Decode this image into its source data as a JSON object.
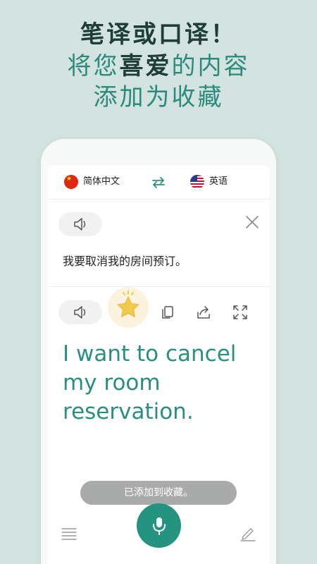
{
  "promo": {
    "line1": "笔译或口译！",
    "line2_pre": "将您",
    "line2_bold": "喜爱",
    "line2_post": "的内容",
    "line3": "添加为收藏"
  },
  "language_bar": {
    "source_language": "简体中文",
    "target_language": "英语",
    "source_flag": "china-flag-icon",
    "target_flag": "usa-flag-icon"
  },
  "source": {
    "text": "我要取消我的房间预订。"
  },
  "result": {
    "text": "I want to cancel my room reservation."
  },
  "toast": {
    "message": "已添加到收藏。"
  },
  "colors": {
    "background": "#d3e3df",
    "accent": "#24937f",
    "result_text": "#2a8f7f",
    "favorite_star": "#f2c94c"
  }
}
